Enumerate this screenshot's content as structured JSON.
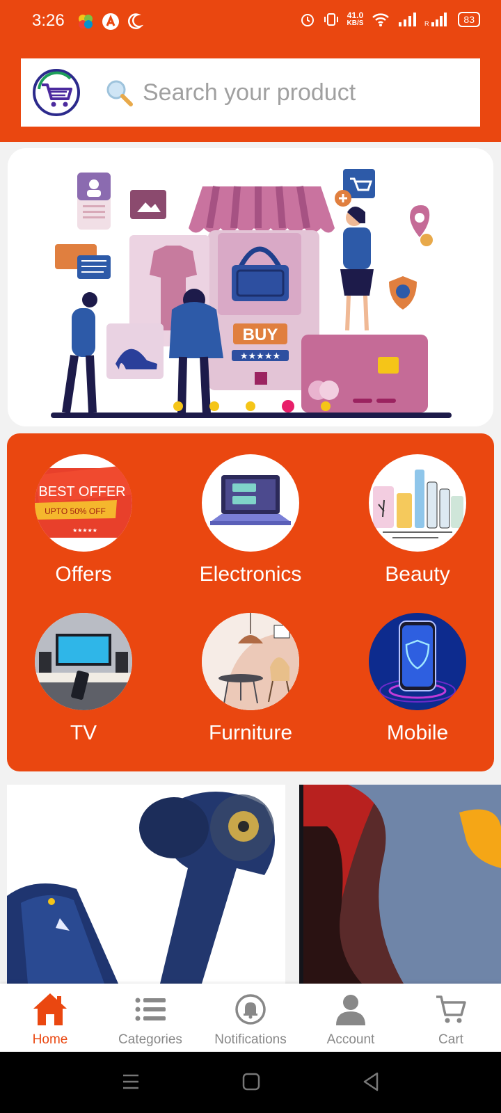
{
  "status_bar": {
    "time": "3:26",
    "net_speed_value": "41.0",
    "net_speed_unit": "KB/S",
    "battery": "83"
  },
  "search": {
    "placeholder": "Search your product",
    "icon": "magnifier-icon"
  },
  "banner": {
    "buy_text": "BUY",
    "slide_count": 5,
    "active_slide": 4
  },
  "categories": [
    {
      "label": "Offers",
      "icon": "best-offer-icon",
      "offer_title": "BEST OFFER",
      "offer_sub": "UPTO 50% OFF"
    },
    {
      "label": "Electronics",
      "icon": "laptop-icon"
    },
    {
      "label": "Beauty",
      "icon": "cosmetics-icon"
    },
    {
      "label": "TV",
      "icon": "tv-icon"
    },
    {
      "label": "Furniture",
      "icon": "furniture-icon"
    },
    {
      "label": "Mobile",
      "icon": "smartphone-icon"
    }
  ],
  "bottom_nav": [
    {
      "label": "Home",
      "icon": "home-icon",
      "active": true
    },
    {
      "label": "Categories",
      "icon": "list-icon",
      "active": false
    },
    {
      "label": "Notifications",
      "icon": "bell-icon",
      "active": false
    },
    {
      "label": "Account",
      "icon": "person-icon",
      "active": false
    },
    {
      "label": "Cart",
      "icon": "cart-icon",
      "active": false
    }
  ],
  "colors": {
    "brand": "#ea4710",
    "dot": "#f5c518",
    "dot_active": "#e81f6a"
  }
}
